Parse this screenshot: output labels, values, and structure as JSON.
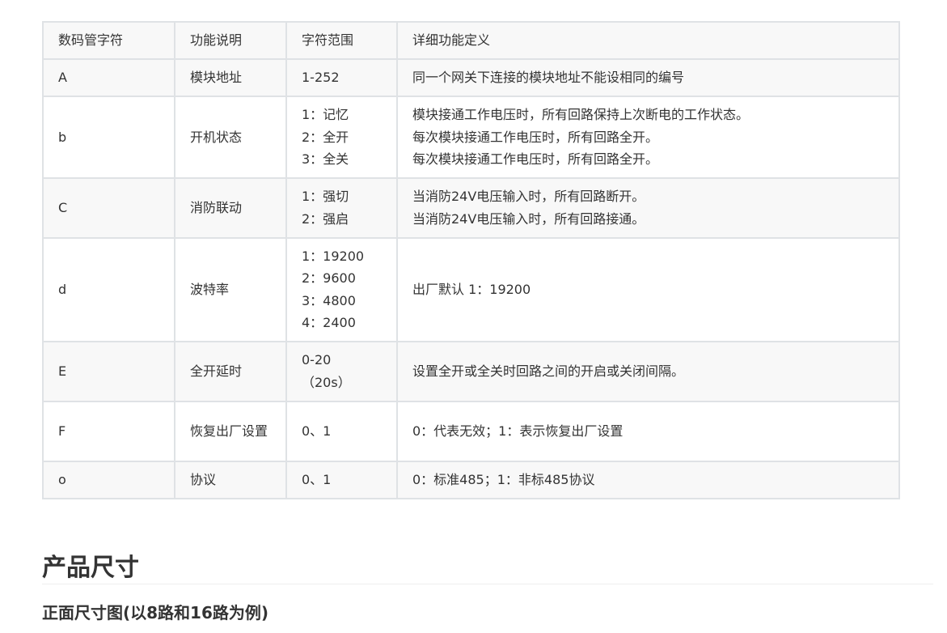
{
  "table": {
    "headers": [
      "数码管字符",
      "功能说明",
      "字符范围",
      "详细功能定义"
    ],
    "rows": [
      {
        "char": "A",
        "function": "模块地址",
        "range": [
          "1-252"
        ],
        "detail": [
          "同一个网关下连接的模块地址不能设相同的编号"
        ]
      },
      {
        "char": "b",
        "function": "开机状态",
        "range": [
          "1：记忆",
          "2：全开",
          "3：全关"
        ],
        "detail": [
          "模块接通工作电压时，所有回路保持上次断电的工作状态。",
          "每次模块接通工作电压时，所有回路全开。",
          "每次模块接通工作电压时，所有回路全开。"
        ]
      },
      {
        "char": "C",
        "function": "消防联动",
        "range": [
          "1：强切",
          "2：强启"
        ],
        "detail": [
          "当消防24V电压输入时，所有回路断开。",
          "当消防24V电压输入时，所有回路接通。"
        ]
      },
      {
        "char": "d",
        "function": "波特率",
        "range": [
          "1：19200",
          "2：9600",
          "3：4800",
          "4：2400"
        ],
        "detail": [
          "出厂默认 1：19200"
        ]
      },
      {
        "char": "E",
        "function": "全开延时",
        "range": [
          "0-20",
          "（20s）"
        ],
        "detail": [
          "设置全开或全关时回路之间的开启或关闭间隔。"
        ]
      },
      {
        "char": "F",
        "function": "恢复出厂设置",
        "range": [
          "0、1"
        ],
        "detail": [
          "0：代表无效；1：表示恢复出厂设置"
        ]
      },
      {
        "char": "o",
        "function": "协议",
        "range": [
          "0、1"
        ],
        "detail": [
          "0：标准485；1：非标485协议"
        ]
      }
    ]
  },
  "section": {
    "title": "产品尺寸",
    "subtitle": "正面尺寸图(以8路和16路为例)"
  }
}
